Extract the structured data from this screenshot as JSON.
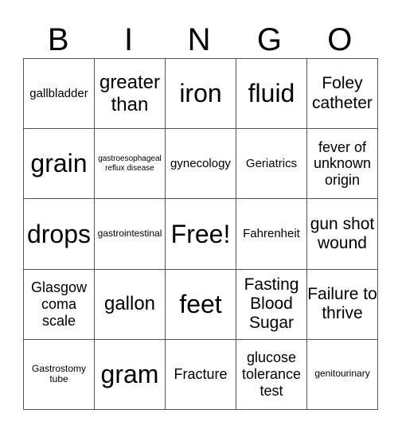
{
  "header": [
    "B",
    "I",
    "N",
    "G",
    "O"
  ],
  "cells": [
    [
      {
        "text": "gallbladder",
        "size": "s-md"
      },
      {
        "text": "greater than",
        "size": "s-xl"
      },
      {
        "text": "iron",
        "size": "s-xxl"
      },
      {
        "text": "fluid",
        "size": "s-xxl"
      },
      {
        "text": "Foley catheter",
        "size": "s-lg"
      }
    ],
    [
      {
        "text": "grain",
        "size": "s-xxl"
      },
      {
        "text": "gastroesophageal reflux disease",
        "size": "s-xs"
      },
      {
        "text": "gynecology",
        "size": "s-md"
      },
      {
        "text": "Geriatrics",
        "size": "s-md"
      },
      {
        "text": "fever of unknown origin",
        "size": "s-ml"
      }
    ],
    [
      {
        "text": "drops",
        "size": "s-xxl"
      },
      {
        "text": "gastrointestinal",
        "size": "s-sm"
      },
      {
        "text": "Free!",
        "size": "s-xxl"
      },
      {
        "text": "Fahrenheit",
        "size": "s-md"
      },
      {
        "text": "gun shot wound",
        "size": "s-lg"
      }
    ],
    [
      {
        "text": "Glasgow coma scale",
        "size": "s-ml"
      },
      {
        "text": "gallon",
        "size": "s-xl"
      },
      {
        "text": "feet",
        "size": "s-xxl"
      },
      {
        "text": "Fasting Blood Sugar",
        "size": "s-lg"
      },
      {
        "text": "Failure to thrive",
        "size": "s-lg"
      }
    ],
    [
      {
        "text": "Gastrostomy tube",
        "size": "s-sm"
      },
      {
        "text": "gram",
        "size": "s-xxl"
      },
      {
        "text": "Fracture",
        "size": "s-ml"
      },
      {
        "text": "glucose tolerance test",
        "size": "s-ml"
      },
      {
        "text": "genitourinary",
        "size": "s-sm"
      }
    ]
  ]
}
